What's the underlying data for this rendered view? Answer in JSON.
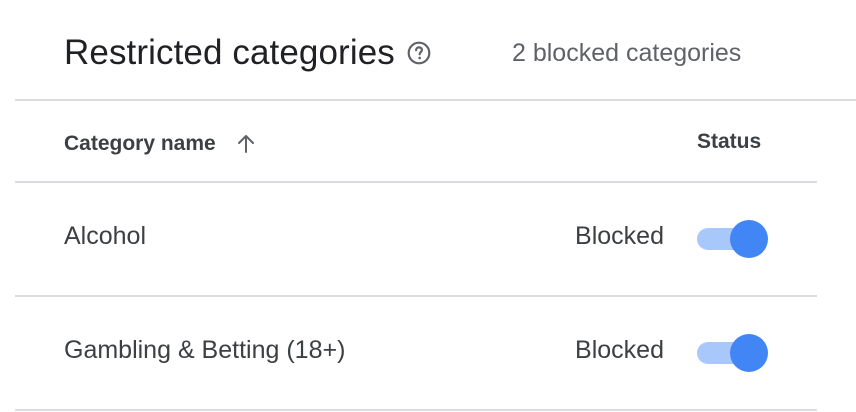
{
  "header": {
    "title": "Restricted categories",
    "help_icon": "help-circle-icon",
    "blocked_count_text": "2 blocked categories"
  },
  "table": {
    "columns": {
      "name": "Category name",
      "name_sort": "arrow-up-icon",
      "status": "Status"
    },
    "rows": [
      {
        "name": "Alcohol",
        "status": "Blocked",
        "toggle_on": true
      },
      {
        "name": "Gambling & Betting (18+)",
        "status": "Blocked",
        "toggle_on": true
      }
    ]
  },
  "colors": {
    "toggle_track_on": "#a8c7fa",
    "toggle_thumb_on": "#4285f4",
    "divider": "#dadce0"
  }
}
